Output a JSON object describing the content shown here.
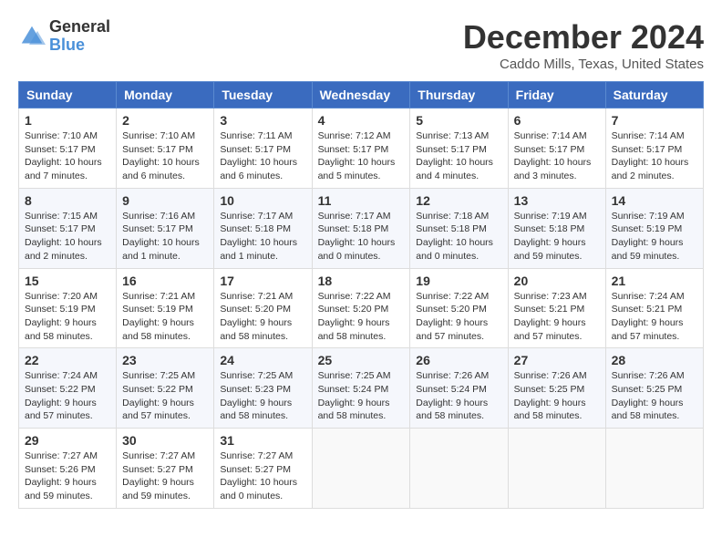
{
  "header": {
    "logo_line1": "General",
    "logo_line2": "Blue",
    "month_title": "December 2024",
    "location": "Caddo Mills, Texas, United States"
  },
  "calendar": {
    "days_of_week": [
      "Sunday",
      "Monday",
      "Tuesday",
      "Wednesday",
      "Thursday",
      "Friday",
      "Saturday"
    ],
    "weeks": [
      [
        {
          "day": "1",
          "sunrise": "7:10 AM",
          "sunset": "5:17 PM",
          "daylight": "10 hours and 7 minutes."
        },
        {
          "day": "2",
          "sunrise": "7:10 AM",
          "sunset": "5:17 PM",
          "daylight": "10 hours and 6 minutes."
        },
        {
          "day": "3",
          "sunrise": "7:11 AM",
          "sunset": "5:17 PM",
          "daylight": "10 hours and 6 minutes."
        },
        {
          "day": "4",
          "sunrise": "7:12 AM",
          "sunset": "5:17 PM",
          "daylight": "10 hours and 5 minutes."
        },
        {
          "day": "5",
          "sunrise": "7:13 AM",
          "sunset": "5:17 PM",
          "daylight": "10 hours and 4 minutes."
        },
        {
          "day": "6",
          "sunrise": "7:14 AM",
          "sunset": "5:17 PM",
          "daylight": "10 hours and 3 minutes."
        },
        {
          "day": "7",
          "sunrise": "7:14 AM",
          "sunset": "5:17 PM",
          "daylight": "10 hours and 2 minutes."
        }
      ],
      [
        {
          "day": "8",
          "sunrise": "7:15 AM",
          "sunset": "5:17 PM",
          "daylight": "10 hours and 2 minutes."
        },
        {
          "day": "9",
          "sunrise": "7:16 AM",
          "sunset": "5:17 PM",
          "daylight": "10 hours and 1 minute."
        },
        {
          "day": "10",
          "sunrise": "7:17 AM",
          "sunset": "5:18 PM",
          "daylight": "10 hours and 1 minute."
        },
        {
          "day": "11",
          "sunrise": "7:17 AM",
          "sunset": "5:18 PM",
          "daylight": "10 hours and 0 minutes."
        },
        {
          "day": "12",
          "sunrise": "7:18 AM",
          "sunset": "5:18 PM",
          "daylight": "10 hours and 0 minutes."
        },
        {
          "day": "13",
          "sunrise": "7:19 AM",
          "sunset": "5:18 PM",
          "daylight": "9 hours and 59 minutes."
        },
        {
          "day": "14",
          "sunrise": "7:19 AM",
          "sunset": "5:19 PM",
          "daylight": "9 hours and 59 minutes."
        }
      ],
      [
        {
          "day": "15",
          "sunrise": "7:20 AM",
          "sunset": "5:19 PM",
          "daylight": "9 hours and 58 minutes."
        },
        {
          "day": "16",
          "sunrise": "7:21 AM",
          "sunset": "5:19 PM",
          "daylight": "9 hours and 58 minutes."
        },
        {
          "day": "17",
          "sunrise": "7:21 AM",
          "sunset": "5:20 PM",
          "daylight": "9 hours and 58 minutes."
        },
        {
          "day": "18",
          "sunrise": "7:22 AM",
          "sunset": "5:20 PM",
          "daylight": "9 hours and 58 minutes."
        },
        {
          "day": "19",
          "sunrise": "7:22 AM",
          "sunset": "5:20 PM",
          "daylight": "9 hours and 57 minutes."
        },
        {
          "day": "20",
          "sunrise": "7:23 AM",
          "sunset": "5:21 PM",
          "daylight": "9 hours and 57 minutes."
        },
        {
          "day": "21",
          "sunrise": "7:24 AM",
          "sunset": "5:21 PM",
          "daylight": "9 hours and 57 minutes."
        }
      ],
      [
        {
          "day": "22",
          "sunrise": "7:24 AM",
          "sunset": "5:22 PM",
          "daylight": "9 hours and 57 minutes."
        },
        {
          "day": "23",
          "sunrise": "7:25 AM",
          "sunset": "5:22 PM",
          "daylight": "9 hours and 57 minutes."
        },
        {
          "day": "24",
          "sunrise": "7:25 AM",
          "sunset": "5:23 PM",
          "daylight": "9 hours and 58 minutes."
        },
        {
          "day": "25",
          "sunrise": "7:25 AM",
          "sunset": "5:24 PM",
          "daylight": "9 hours and 58 minutes."
        },
        {
          "day": "26",
          "sunrise": "7:26 AM",
          "sunset": "5:24 PM",
          "daylight": "9 hours and 58 minutes."
        },
        {
          "day": "27",
          "sunrise": "7:26 AM",
          "sunset": "5:25 PM",
          "daylight": "9 hours and 58 minutes."
        },
        {
          "day": "28",
          "sunrise": "7:26 AM",
          "sunset": "5:25 PM",
          "daylight": "9 hours and 58 minutes."
        }
      ],
      [
        {
          "day": "29",
          "sunrise": "7:27 AM",
          "sunset": "5:26 PM",
          "daylight": "9 hours and 59 minutes."
        },
        {
          "day": "30",
          "sunrise": "7:27 AM",
          "sunset": "5:27 PM",
          "daylight": "9 hours and 59 minutes."
        },
        {
          "day": "31",
          "sunrise": "7:27 AM",
          "sunset": "5:27 PM",
          "daylight": "10 hours and 0 minutes."
        },
        null,
        null,
        null,
        null
      ]
    ]
  }
}
